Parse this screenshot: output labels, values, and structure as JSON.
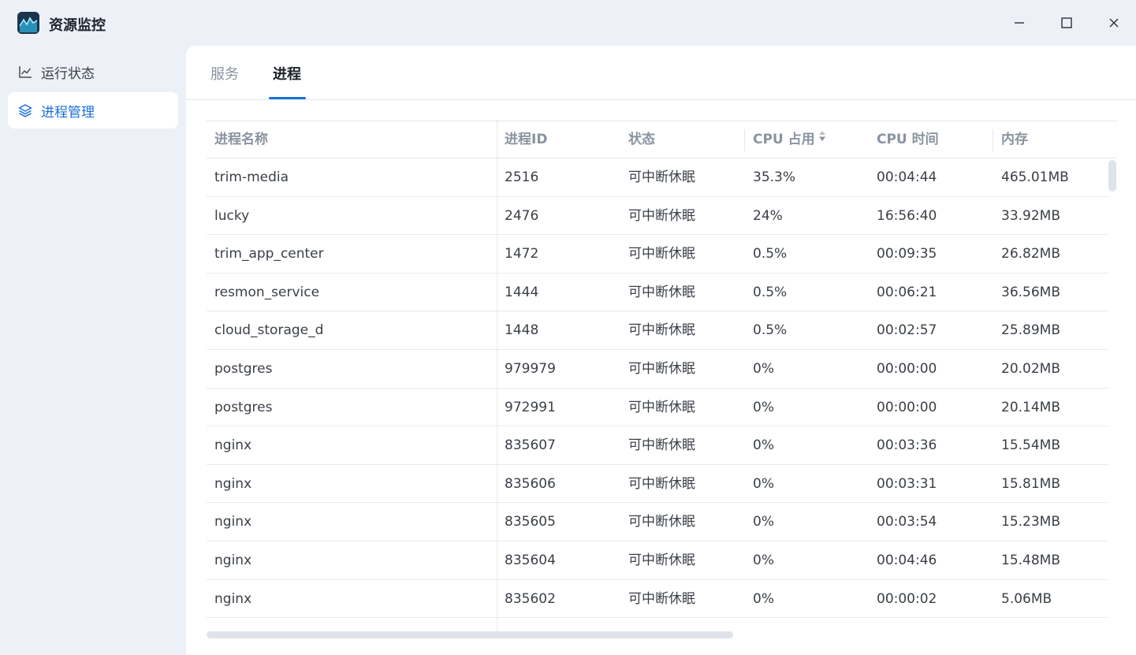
{
  "app": {
    "title": "资源监控",
    "icon": "resource-monitor-app-icon"
  },
  "window_controls": {
    "minimize": "minimize-icon",
    "maximize": "maximize-icon",
    "close": "close-icon"
  },
  "sidebar": {
    "items": [
      {
        "label": "运行状态",
        "icon": "line-chart-icon",
        "active": false
      },
      {
        "label": "进程管理",
        "icon": "layers-icon",
        "active": true
      }
    ]
  },
  "tabs": [
    {
      "label": "服务",
      "active": false
    },
    {
      "label": "进程",
      "active": true
    }
  ],
  "table": {
    "columns": [
      "进程名称",
      "进程ID",
      "状态",
      "CPU 占用",
      "CPU 时间",
      "内存"
    ],
    "sorted_column": "CPU 占用",
    "rows": [
      [
        "trim-media",
        "2516",
        "可中断休眠",
        "35.3%",
        "00:04:44",
        "465.01MB"
      ],
      [
        "lucky",
        "2476",
        "可中断休眠",
        "24%",
        "16:56:40",
        "33.92MB"
      ],
      [
        "trim_app_center",
        "1472",
        "可中断休眠",
        "0.5%",
        "00:09:35",
        "26.82MB"
      ],
      [
        "resmon_service",
        "1444",
        "可中断休眠",
        "0.5%",
        "00:06:21",
        "36.56MB"
      ],
      [
        "cloud_storage_d",
        "1448",
        "可中断休眠",
        "0.5%",
        "00:02:57",
        "25.89MB"
      ],
      [
        "postgres",
        "979979",
        "可中断休眠",
        "0%",
        "00:00:00",
        "20.02MB"
      ],
      [
        "postgres",
        "972991",
        "可中断休眠",
        "0%",
        "00:00:00",
        "20.14MB"
      ],
      [
        "nginx",
        "835607",
        "可中断休眠",
        "0%",
        "00:03:36",
        "15.54MB"
      ],
      [
        "nginx",
        "835606",
        "可中断休眠",
        "0%",
        "00:03:31",
        "15.81MB"
      ],
      [
        "nginx",
        "835605",
        "可中断休眠",
        "0%",
        "00:03:54",
        "15.23MB"
      ],
      [
        "nginx",
        "835604",
        "可中断休眠",
        "0%",
        "00:04:46",
        "15.48MB"
      ],
      [
        "nginx",
        "835602",
        "可中断休眠",
        "0%",
        "00:00:02",
        "5.06MB"
      ]
    ]
  },
  "colors": {
    "accent": "#1a6fd8",
    "background": "#edf1f7",
    "panel": "#ffffff"
  }
}
